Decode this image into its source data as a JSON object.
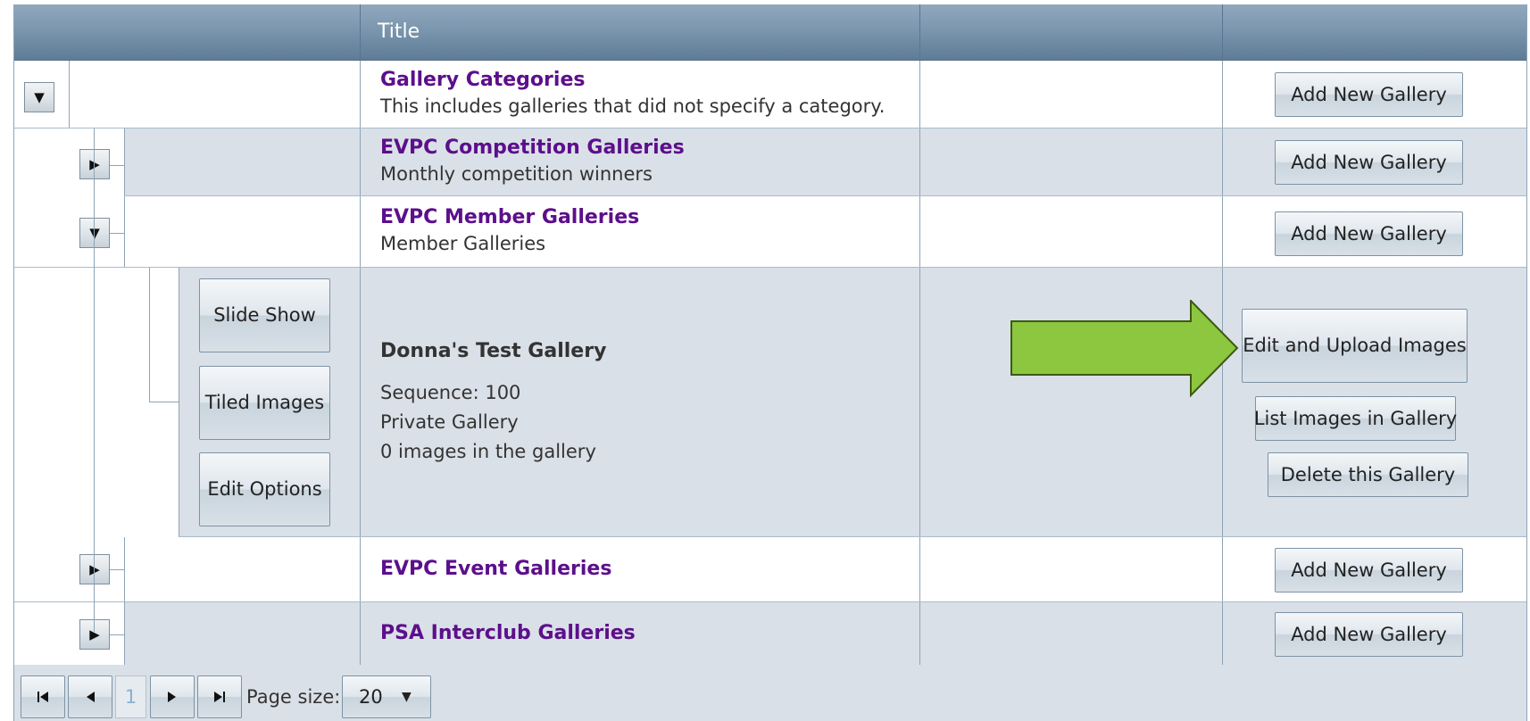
{
  "header": {
    "title": "Title"
  },
  "rows": {
    "gallery_categories": {
      "title": "Gallery Categories",
      "description": "This includes galleries that did not specify a category.",
      "action": "Add New Gallery",
      "expander": "▼"
    },
    "competition": {
      "title": "EVPC Competition Galleries",
      "description": "Monthly competition winners",
      "action": "Add New Gallery",
      "expander": "▶"
    },
    "member": {
      "title": "EVPC Member Galleries",
      "description": "Member Galleries",
      "action": "Add New Gallery",
      "expander": "▼"
    },
    "event": {
      "title": "EVPC Event Galleries",
      "action": "Add New Gallery",
      "expander": "▶"
    },
    "psa": {
      "title": "PSA Interclub Galleries",
      "action": "Add New Gallery",
      "expander": "▶"
    }
  },
  "gallery": {
    "title": "Donna's Test Gallery",
    "sequence": "Sequence: 100",
    "privacy": "Private Gallery",
    "image_count": "0 images in the gallery",
    "left_buttons": {
      "slide_show": "Slide Show",
      "tiled_images": "Tiled Images",
      "edit_options": "Edit Options"
    },
    "right_buttons": {
      "edit_upload": "Edit and Upload Images",
      "list_images": "List Images in Gallery",
      "delete": "Delete this Gallery"
    },
    "arrow_color": "#8dc63f"
  },
  "pager": {
    "first_icon": "first-page-icon",
    "prev_icon": "prev-page-icon",
    "current_page": "1",
    "next_icon": "next-page-icon",
    "last_icon": "last-page-icon",
    "page_size_label": "Page size:",
    "page_size_value": "20"
  },
  "colors": {
    "header": "#7b96ae",
    "category_link": "#5c0f8b",
    "alt_row": "#dae0e7"
  }
}
